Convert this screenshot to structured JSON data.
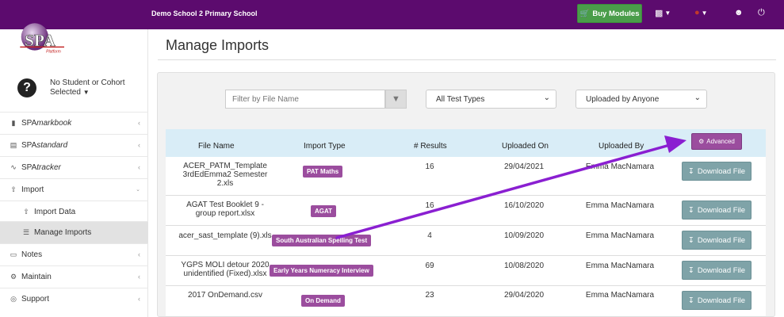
{
  "header": {
    "school_name": "Demo School 2 Primary School",
    "buy_label": "Buy Modules",
    "icons": [
      "cart-icon",
      "sitemap-icon",
      "paw-icon",
      "user-icon",
      "power-icon"
    ]
  },
  "sidebar": {
    "logo_text": "SPA",
    "logo_sub": "Platform",
    "cohort_line1": "No Student or Cohort",
    "cohort_line2": "Selected",
    "items": [
      {
        "prefix": "SPA",
        "suffix": "markbook"
      },
      {
        "prefix": "SPA",
        "suffix": "standard"
      },
      {
        "prefix": "SPA",
        "suffix": "tracker"
      },
      {
        "label": "Import"
      },
      {
        "label": "Import Data"
      },
      {
        "label": "Manage Imports"
      },
      {
        "label": "Notes"
      },
      {
        "label": "Maintain"
      },
      {
        "label": "Support"
      }
    ]
  },
  "main": {
    "title": "Manage Imports",
    "filter_placeholder": "Filter by File Name",
    "test_type_select": "All Test Types",
    "uploaded_by_select": "Uploaded by Anyone",
    "advanced_label": "Advanced",
    "columns": [
      "File Name",
      "Import Type",
      "# Results",
      "Uploaded On",
      "Uploaded By"
    ],
    "download_label": "Download File",
    "rows": [
      {
        "file_lines": [
          "ACER_PATM_Template",
          "3rdEdEmma2 Semester",
          "2.xls"
        ],
        "type": "PAT Maths",
        "results": "16",
        "date": "29/04/2021",
        "by": "Emma MacNamara"
      },
      {
        "file_lines": [
          "AGAT Test Booklet 9 -",
          "group report.xlsx"
        ],
        "type": "AGAT",
        "results": "16",
        "date": "16/10/2020",
        "by": "Emma MacNamara"
      },
      {
        "file_lines": [
          "acer_sast_template (9).xls"
        ],
        "type": "South Australian Spelling Test",
        "results": "4",
        "date": "10/09/2020",
        "by": "Emma MacNamara"
      },
      {
        "file_lines": [
          "YGPS MOLI detour 2020",
          "unidentified (Fixed).xlsx"
        ],
        "type": "Early Years Numeracy Interview",
        "results": "69",
        "date": "10/08/2020",
        "by": "Emma MacNamara"
      },
      {
        "file_lines": [
          "2017 OnDemand.csv"
        ],
        "type": "On Demand",
        "results": "23",
        "date": "29/04/2020",
        "by": "Emma MacNamara"
      }
    ]
  },
  "colors": {
    "header_bg": "#5c0b6e",
    "accent_purple": "#9b4d9e",
    "arrow": "#8a1fd1",
    "buy_green": "#4a9d4a",
    "download_teal": "#7fa3a8",
    "table_header": "#d9edf7"
  }
}
